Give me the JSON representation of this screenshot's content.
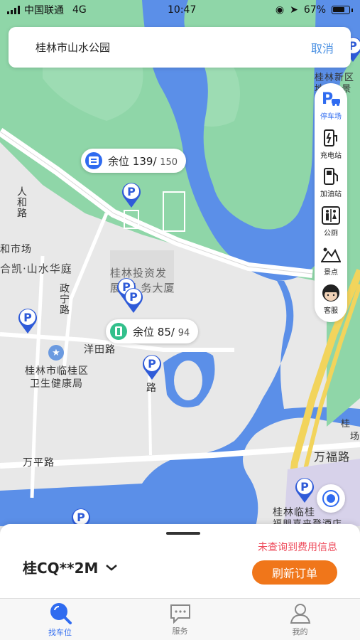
{
  "status_bar": {
    "carrier": "中国联通",
    "network": "4G",
    "time": "10:47",
    "battery": "67%"
  },
  "search": {
    "value": "桂林市山水公园",
    "cancel_label": "取消"
  },
  "side_panel": {
    "items": [
      {
        "label": "停车场",
        "icon": "parking-icon",
        "active": true
      },
      {
        "label": "充电站",
        "icon": "charging-station-icon"
      },
      {
        "label": "加油站",
        "icon": "gas-station-icon"
      },
      {
        "label": "公厕",
        "icon": "restroom-icon"
      },
      {
        "label": "景点",
        "icon": "scenic-spot-icon"
      },
      {
        "label": "客服",
        "icon": "customer-service-icon"
      }
    ]
  },
  "map": {
    "labels": {
      "guilin_xinqu": "桂林新区",
      "guilin_xinqu_sub": "地 桑 景",
      "renhe_road": "人和路",
      "market": "和市场",
      "hekai": "合凯·山水华庭",
      "zhengning_road": "政宁路",
      "guilin_invest": "桂林投资发",
      "guilin_invest_2": "展 服 务大厦",
      "yangtian_road": "洋田路",
      "health_bureau_1": "桂林市临桂区",
      "health_bureau_2": "卫生健康局",
      "wanping_road": "万平路",
      "wanfu_road": "万福路",
      "guilin_lin": "桂林临桂",
      "hotel": "福朋喜来登酒店",
      "road_char": "路",
      "gui_right": "桂",
      "chang_right": "场"
    },
    "bubbles": [
      {
        "available_label": "余位",
        "available": "139",
        "total": "150",
        "icon": "parking-garage-icon"
      },
      {
        "available_label": "余位",
        "available": "85",
        "total": "94",
        "icon": "parking-lot-icon"
      }
    ],
    "colors": {
      "water": "#5b8fe8",
      "park": "#8fd6a8",
      "road": "#ffffff",
      "highway": "#f2d45c",
      "pin": "#2f5bd8"
    }
  },
  "bottom_sheet": {
    "plate": "桂CQ**2M",
    "fee_status": "未查询到费用信息",
    "refresh_label": "刷新订单"
  },
  "tab_bar": {
    "tabs": [
      {
        "label": "找车位",
        "icon": "search-icon",
        "active": true
      },
      {
        "label": "服务",
        "icon": "chat-bubble-icon"
      },
      {
        "label": "我的",
        "icon": "user-icon"
      }
    ]
  }
}
